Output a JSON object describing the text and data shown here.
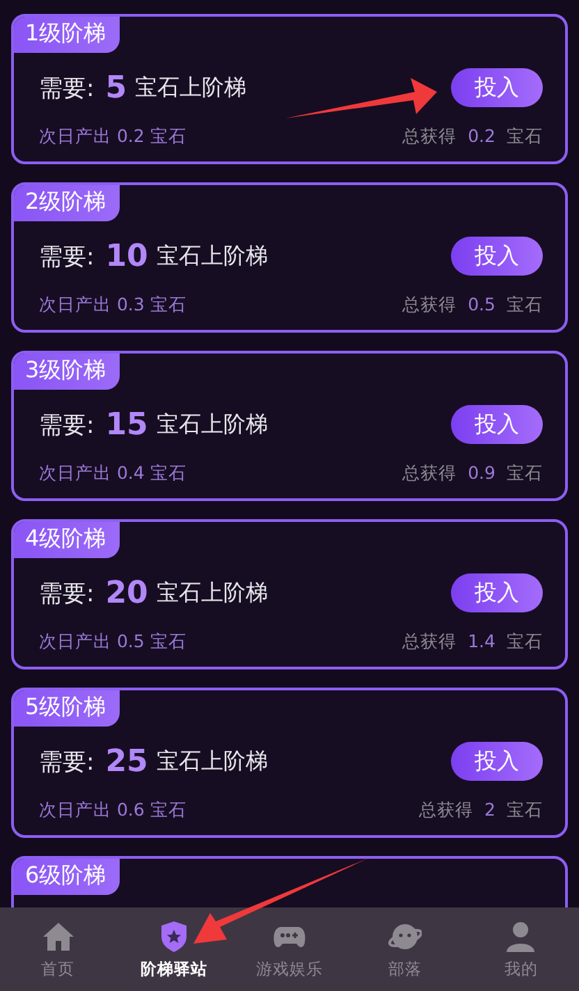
{
  "cards": [
    {
      "title": "1级阶梯",
      "need_label": "需要:",
      "amount": "5",
      "amount_suffix": "宝石上阶梯",
      "button": "投入",
      "daily": "次日产出 0.2 宝石",
      "total_label": "总获得",
      "total_value": "0.2",
      "total_unit": "宝石"
    },
    {
      "title": "2级阶梯",
      "need_label": "需要:",
      "amount": "10",
      "amount_suffix": "宝石上阶梯",
      "button": "投入",
      "daily": "次日产出 0.3 宝石",
      "total_label": "总获得",
      "total_value": "0.5",
      "total_unit": "宝石"
    },
    {
      "title": "3级阶梯",
      "need_label": "需要:",
      "amount": "15",
      "amount_suffix": "宝石上阶梯",
      "button": "投入",
      "daily": "次日产出 0.4 宝石",
      "total_label": "总获得",
      "total_value": "0.9",
      "total_unit": "宝石"
    },
    {
      "title": "4级阶梯",
      "need_label": "需要:",
      "amount": "20",
      "amount_suffix": "宝石上阶梯",
      "button": "投入",
      "daily": "次日产出 0.5 宝石",
      "total_label": "总获得",
      "total_value": "1.4",
      "total_unit": "宝石"
    },
    {
      "title": "5级阶梯",
      "need_label": "需要:",
      "amount": "25",
      "amount_suffix": "宝石上阶梯",
      "button": "投入",
      "daily": "次日产出 0.6 宝石",
      "total_label": "总获得",
      "total_value": "2",
      "total_unit": "宝石"
    },
    {
      "title": "6级阶梯"
    }
  ],
  "tab_bar": [
    {
      "kind": "home",
      "label": "首页",
      "selected": false
    },
    {
      "kind": "badge",
      "label": "阶梯驿站",
      "selected": true
    },
    {
      "kind": "gamepad",
      "label": "游戏娱乐",
      "selected": false
    },
    {
      "kind": "planet",
      "label": "部落",
      "selected": false
    },
    {
      "kind": "person",
      "label": "我的",
      "selected": false
    }
  ]
}
